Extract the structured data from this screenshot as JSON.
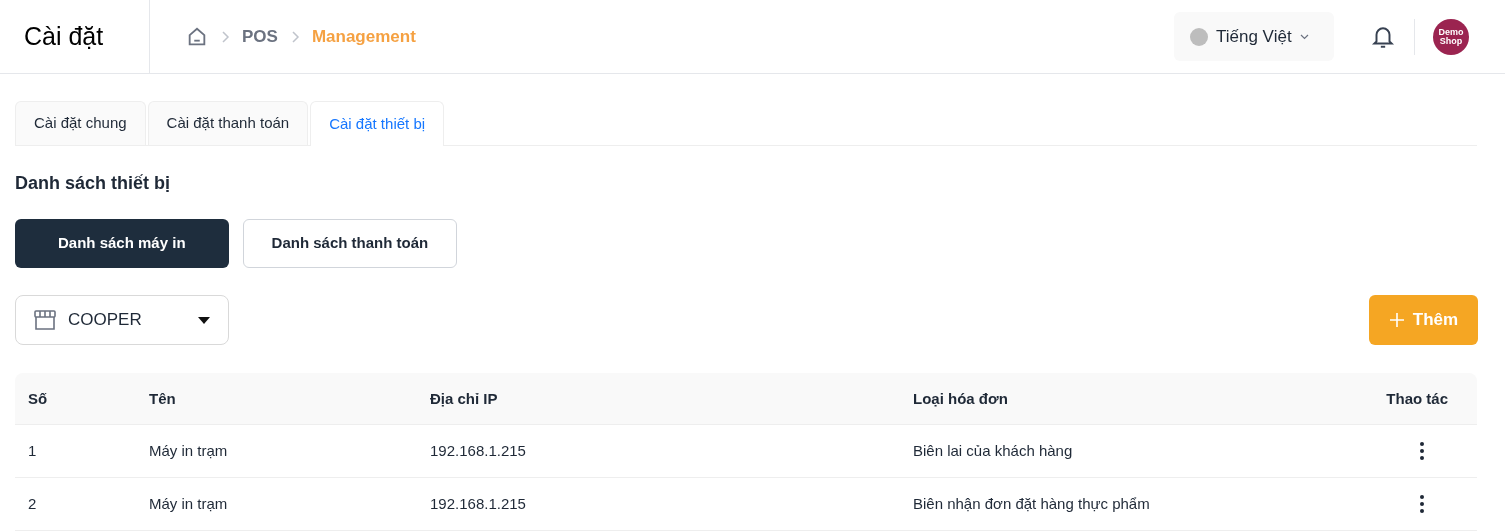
{
  "header": {
    "title": "Cài đặt",
    "breadcrumb": [
      "POS",
      "Management"
    ],
    "language": "Tiếng Việt",
    "avatar_text": "Demo Shop"
  },
  "tabs": [
    {
      "label": "Cài đặt chung",
      "selected": false
    },
    {
      "label": "Cài đặt thanh toán",
      "selected": false
    },
    {
      "label": "Cài đặt thiết bị",
      "selected": true
    }
  ],
  "section_title": "Danh sách thiết bị",
  "lists": [
    {
      "label": "Danh sách máy in",
      "selected": true
    },
    {
      "label": "Danh sách thanh toán",
      "selected": false
    }
  ],
  "store_select": {
    "value": "COOPER"
  },
  "add_button": "Thêm",
  "table": {
    "columns": [
      "Số",
      "Tên",
      "Địa chỉ IP",
      "Loại hóa đơn",
      "Thao tác"
    ],
    "rows": [
      [
        "1",
        "Máy in trạm",
        "192.168.1.215",
        "Biên lai của khách hàng"
      ],
      [
        "2",
        "Máy in trạm",
        "192.168.1.215",
        "Biên nhận đơn đặt hàng thực phẩm"
      ]
    ]
  }
}
